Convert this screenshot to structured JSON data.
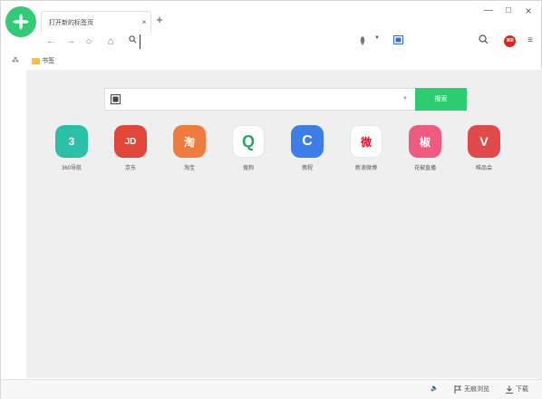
{
  "window": {
    "tab_title": "打开新的标签页",
    "tab_close": "×",
    "new_tab": "+",
    "minimize": "—",
    "maximize": "□",
    "close": "×"
  },
  "nav": {
    "back": "←",
    "forward": "→",
    "reload": "○",
    "home": "⌂",
    "address_value": "",
    "engine_dropdown": "▼",
    "search_value": "",
    "avatar_text": "360",
    "menu": "≡"
  },
  "bookmarks": {
    "toggle": "⁂",
    "items": [
      {
        "label": "书签"
      }
    ]
  },
  "main": {
    "search_value": "",
    "search_dropdown": "▼",
    "search_button": "搜索",
    "tiles": [
      {
        "label": "360导航",
        "glyph": "3",
        "color": "#2bbfa8"
      },
      {
        "label": "京东",
        "glyph": "JD",
        "color": "#e0473a"
      },
      {
        "label": "淘宝",
        "glyph": "淘",
        "color": "#f07b3f"
      },
      {
        "label": "搜狗",
        "glyph": "Q",
        "color": "#ffffff"
      },
      {
        "label": "携程",
        "glyph": "C",
        "color": "#3d7ee8"
      },
      {
        "label": "新浪微博",
        "glyph": "微",
        "color": "#ffffff"
      },
      {
        "label": "花椒直播",
        "glyph": "椒",
        "color": "#ef5a80"
      },
      {
        "label": "唯品会",
        "glyph": "V",
        "color": "#e14a4a"
      }
    ]
  },
  "status": {
    "sound_icon": "🔈",
    "ad_block": "无痕浏览",
    "download": "下载"
  }
}
